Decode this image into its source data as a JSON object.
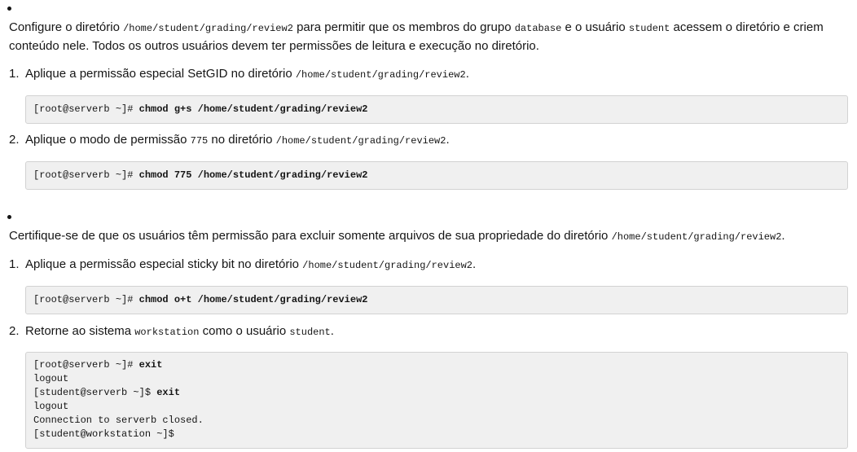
{
  "section1": {
    "intro": {
      "t1": "Configure o diretório ",
      "c1": "/home/student/grading/review2",
      "t2": " para permitir que os membros do grupo ",
      "c2": "database",
      "t3": " e o usuário ",
      "c3": "student",
      "t4": " acessem o diretório e criem conteúdo nele. Todos os outros usuários devem ter permissões de leitura e execução no diretório."
    },
    "step1": {
      "num": "1.",
      "t1": "Aplique a permissão especial SetGID no diretório ",
      "c1": "/home/student/grading/review2",
      "t2": ".",
      "prompt": "[root@serverb ~]# ",
      "cmd": "chmod g+s /home/student/grading/review2"
    },
    "step2": {
      "num": "2.",
      "t1": "Aplique o modo de permissão ",
      "c1": "775",
      "t2": " no diretório ",
      "c2": "/home/student/grading/review2",
      "t3": ".",
      "prompt": "[root@serverb ~]# ",
      "cmd": "chmod 775 /home/student/grading/review2"
    }
  },
  "section2": {
    "intro": {
      "t1": "Certifique-se de que os usuários têm permissão para excluir somente arquivos de sua propriedade do diretório ",
      "c1": "/home/student/grading/review2",
      "t2": "."
    },
    "step1": {
      "num": "1.",
      "t1": "Aplique a permissão especial sticky bit no diretório ",
      "c1": "/home/student/grading/review2",
      "t2": ".",
      "prompt": "[root@serverb ~]# ",
      "cmd": "chmod o+t /home/student/grading/review2"
    },
    "step2": {
      "num": "2.",
      "t1": "Retorne ao sistema ",
      "c1": "workstation",
      "t2": " como o usuário ",
      "c2": "student",
      "t3": ".",
      "lines": [
        {
          "prompt": "[root@serverb ~]# ",
          "cmd": "exit"
        },
        {
          "prompt": "logout",
          "cmd": ""
        },
        {
          "prompt": "[student@serverb ~]$ ",
          "cmd": "exit"
        },
        {
          "prompt": "logout",
          "cmd": ""
        },
        {
          "prompt": "Connection to serverb closed.",
          "cmd": ""
        },
        {
          "prompt": "[student@workstation ~]$",
          "cmd": ""
        }
      ]
    }
  }
}
